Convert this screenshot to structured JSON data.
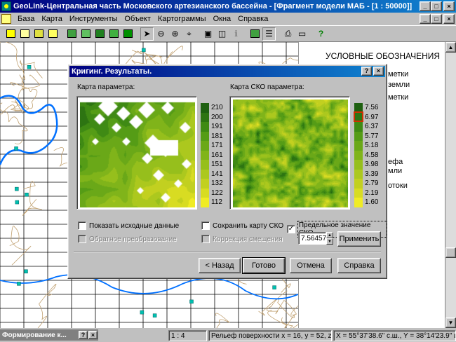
{
  "window": {
    "title": "GeoLink-Центральная часть Московского артезианского бассейна - [Фрагмент модели МАБ - [1 : 50000]]",
    "min": "_",
    "max": "□",
    "close": "×"
  },
  "menu": [
    "База",
    "Карта",
    "Инструменты",
    "Объект",
    "Картограммы",
    "Окна",
    "Справка"
  ],
  "toolbar_icons": [
    "open-db-icon",
    "layers-icon",
    "copy-layer-icon",
    "export-icon",
    "grid-icon",
    "chart-icon",
    "table-icon",
    "cartogram-icon",
    "edit-icon",
    "pointer-icon",
    "zoom-out-icon",
    "zoom-in-icon",
    "zoom-fit-icon",
    "info-icon",
    "measure-icon",
    "query-icon",
    "layers-toggle-icon",
    "legend-icon",
    "print-icon",
    "window-icon",
    "help-icon"
  ],
  "legend": {
    "title": "УСЛОВНЫЕ ОБОЗНАЧЕНИЯ",
    "items": [
      "метки",
      "земли",
      "метки",
      "ефа",
      "мли",
      "отоки"
    ]
  },
  "dialog": {
    "title": "Кригинг. Результаты.",
    "help": "?",
    "close": "×",
    "left_map_label": "Карта параметра:",
    "right_map_label": "Карта СКО параметра:",
    "show_source": "Показать исходные данные",
    "inverse_transform": "Обратное преобразование",
    "save_sko": "Сохранить карту СКО",
    "bias_correction": "Коррекция смещения",
    "limit_sko": "Предельное значение СКО",
    "limit_value": "7.56457",
    "apply": "Применить",
    "back": "< Назад",
    "done": "Готово",
    "cancel": "Отмена",
    "help_btn": "Справка",
    "check_mark": "✓"
  },
  "left_scale": {
    "ticks": [
      "210",
      "200",
      "191",
      "181",
      "171",
      "161",
      "151",
      "141",
      "132",
      "122",
      "112"
    ],
    "colors": [
      "#1e6010",
      "#2d7412",
      "#3f8a14",
      "#559c16",
      "#6aa818",
      "#80b41a",
      "#96bf1c",
      "#acc81e",
      "#c2d020",
      "#d8dc22",
      "#f0ec24"
    ]
  },
  "right_scale": {
    "ticks": [
      "7.56",
      "6.97",
      "6.37",
      "5.77",
      "5.18",
      "4.58",
      "3.98",
      "3.39",
      "2.79",
      "2.19",
      "1.60"
    ],
    "colors": [
      "#1e6010",
      "#2d7412",
      "#3f8a14",
      "#559c16",
      "#6aa818",
      "#80b41a",
      "#96bf1c",
      "#acc81e",
      "#c2d020",
      "#d8dc22",
      "#f0ec24"
    ]
  },
  "status": {
    "minimized_window": "Формирование к...",
    "min_btn_q": "?",
    "min_btn_x": "×",
    "scale": "1 : 4",
    "surface": "Рельеф поверхности x = 16, y = 52, z = ?",
    "coords": "X = 55°37'38.6\" с.ш., Y = 38°14'23.9\" в.д."
  }
}
